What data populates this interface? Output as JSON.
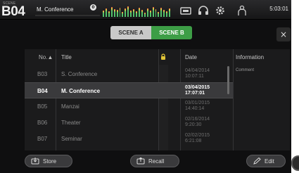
{
  "topbar": {
    "scene_tag": "SCENE",
    "scene_number": "B04",
    "scene_title": "M. Conference",
    "info_badge": "0",
    "time": "5:03:01"
  },
  "tabs": [
    {
      "label": "SCENE A",
      "selected": false
    },
    {
      "label": "SCENE B",
      "selected": true
    }
  ],
  "close_label": "×",
  "list": {
    "headers": {
      "no": "No.▲",
      "title": "Title",
      "date": "Date",
      "information": "Information"
    },
    "information_comment": "Comment",
    "rows": [
      {
        "no": "B03",
        "title": "S. Conference",
        "date": "04/04/2014",
        "time": "10:07:11",
        "selected": false
      },
      {
        "no": "B04",
        "title": "M. Conference",
        "date": "03/04/2015",
        "time": "17:07:01",
        "selected": true
      },
      {
        "no": "B05",
        "title": "Manzai",
        "date": "03/01/2015",
        "time": "14:40:14",
        "selected": false
      },
      {
        "no": "B06",
        "title": "Theater",
        "date": "02/16/2014",
        "time": "9:20:30",
        "selected": false
      },
      {
        "no": "B07",
        "title": "Seminar",
        "date": "02/02/2015",
        "time": "6:21:08",
        "selected": false
      }
    ]
  },
  "buttons": {
    "store": "Store",
    "recall": "Recall",
    "edit": "Edit"
  },
  "colors": {
    "accent_green": "#3d9e46",
    "background": "#0f0f10",
    "panel": "#1b1b1c"
  },
  "icons": [
    "info-icon",
    "meter-icon",
    "display-icon",
    "headphones-icon",
    "gear-icon",
    "user-icon",
    "lock-icon",
    "store-icon",
    "recall-icon",
    "pencil-icon",
    "close-icon"
  ]
}
